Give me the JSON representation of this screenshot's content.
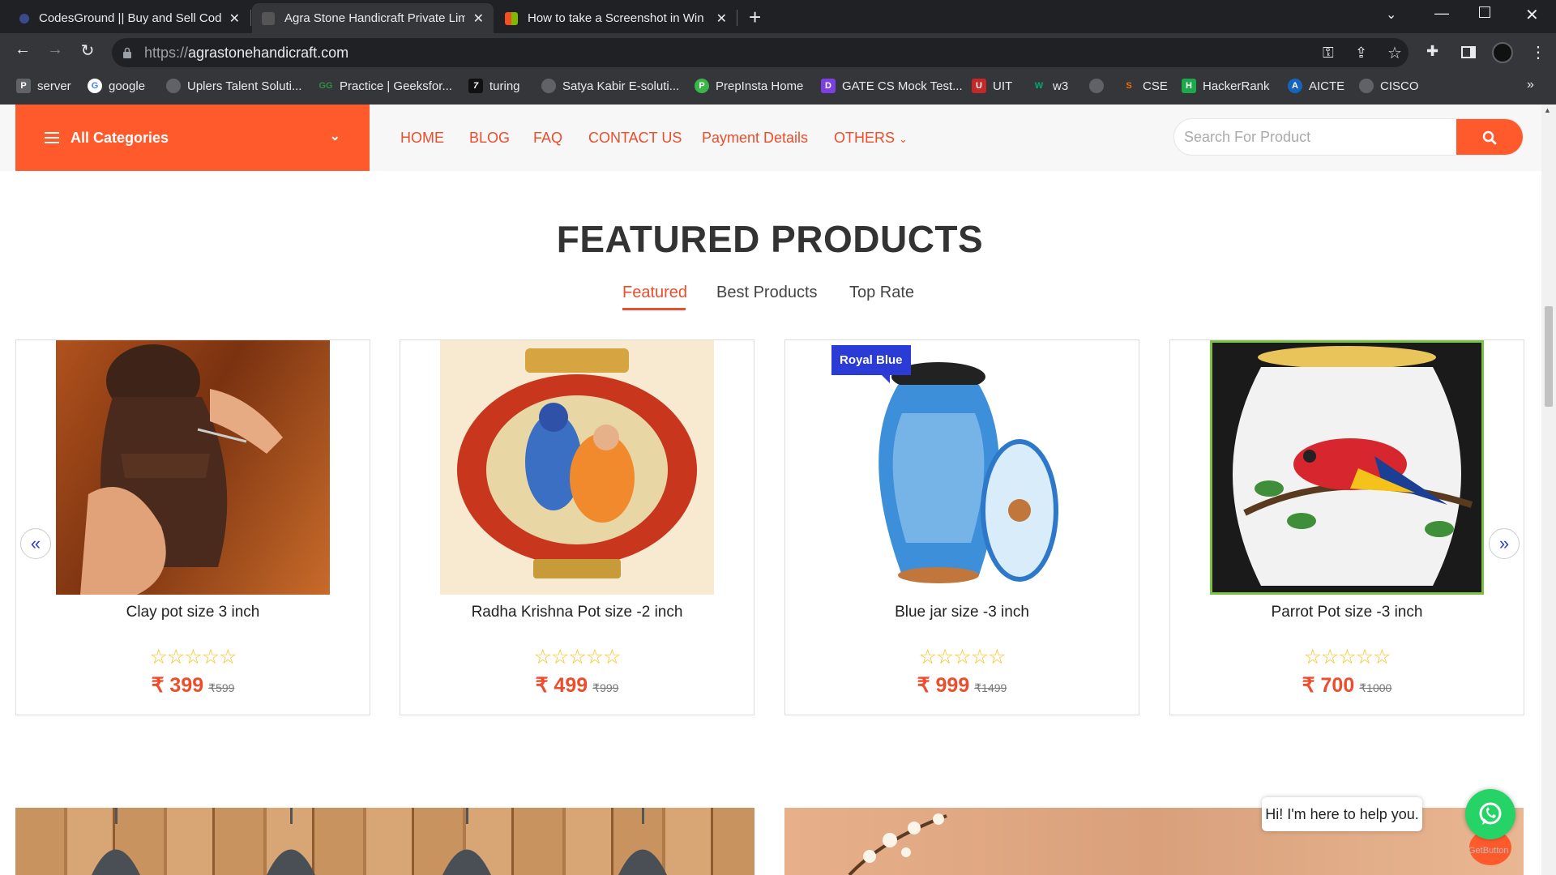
{
  "browser": {
    "tabs": [
      {
        "title": "CodesGround || Buy and Sell Cod",
        "favicon_color": "#3b4a8c"
      },
      {
        "title": "Agra Stone Handicraft Private Lim",
        "favicon_color": "#555555"
      },
      {
        "title": "How to take a Screenshot in Win",
        "favicon_color": "#f25022"
      }
    ],
    "url_scheme": "https://",
    "url_host": "agrastonehandicraft.com",
    "bookmarks": [
      {
        "label": "server",
        "icon": "P",
        "color": "#5f6368"
      },
      {
        "label": "google",
        "icon": "G",
        "color": "#4285f4"
      },
      {
        "label": "Uplers Talent Soluti...",
        "icon": "",
        "color": "#5f6368"
      },
      {
        "label": "Practice | Geeksfor...",
        "icon": "GG",
        "color": "#2f8d46"
      },
      {
        "label": "turing",
        "icon": "7",
        "color": "#111111"
      },
      {
        "label": "Satya Kabir E-soluti...",
        "icon": "",
        "color": "#5f6368"
      },
      {
        "label": "PrepInsta Home",
        "icon": "P",
        "color": "#3ab54a"
      },
      {
        "label": "GATE CS Mock Test...",
        "icon": "D",
        "color": "#7b3fe4"
      },
      {
        "label": "UIT",
        "icon": "U",
        "color": "#c62828"
      },
      {
        "label": "w3",
        "icon": "W",
        "color": "#04aa6d"
      },
      {
        "label": "",
        "icon": "",
        "color": "#5f6368"
      },
      {
        "label": "CSE",
        "icon": "S",
        "color": "#e8710a"
      },
      {
        "label": "HackerRank",
        "icon": "H",
        "color": "#1ba94c"
      },
      {
        "label": "AICTE",
        "icon": "A",
        "color": "#1565c0"
      },
      {
        "label": "CISCO",
        "icon": "",
        "color": "#5f6368"
      }
    ]
  },
  "header": {
    "categories_label": "All Categories",
    "menu": [
      "HOME",
      "BLOG",
      "FAQ",
      "CONTACT US",
      "Payment Details",
      "OTHERS"
    ],
    "search_placeholder": "Search For Product"
  },
  "featured": {
    "heading": "FEATURED PRODUCTS",
    "tabs": [
      "Featured",
      "Best Products",
      "Top Rate"
    ],
    "products": [
      {
        "name": "Clay pot size 3 inch",
        "price": "₹ 399",
        "old_price": "₹599",
        "stars": "☆☆☆☆☆",
        "badge": ""
      },
      {
        "name": "Radha Krishna Pot size -2 inch",
        "price": "₹ 499",
        "old_price": "₹999",
        "stars": "☆☆☆☆☆",
        "badge": ""
      },
      {
        "name": "Blue jar size -3 inch",
        "price": "₹ 999",
        "old_price": "₹1499",
        "stars": "☆☆☆☆☆",
        "badge": "Royal Blue"
      },
      {
        "name": "Parrot Pot size -3 inch",
        "price": "₹ 700",
        "old_price": "₹1000",
        "stars": "☆☆☆☆☆",
        "badge": ""
      }
    ]
  },
  "chat": {
    "help_text": "Hi! I'm here to help you.",
    "powered_by": "GetButton"
  },
  "colors": {
    "accent": "#ff5a2c",
    "link": "#ec4d2b",
    "badge": "#2a3bd6",
    "star": "#f7c21b"
  }
}
